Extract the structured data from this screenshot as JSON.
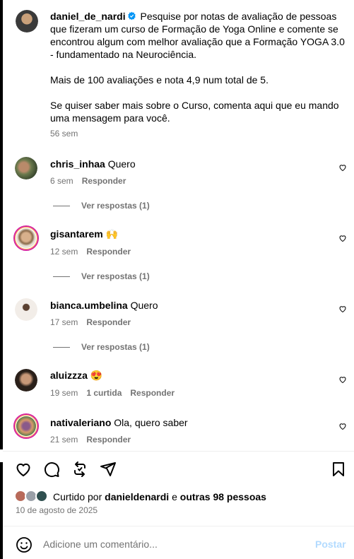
{
  "post": {
    "author": "daniel_de_nardi",
    "caption_p1": "Pesquise por notas de avaliação de pessoas que fizeram um curso de Formação de Yoga Online e comente se encontrou algum com melhor avaliação que a Formação YOGA 3.0 - fundamentado na Neurociência.",
    "caption_p2": "Mais de 100 avaliações e nota 4,9 num total de 5.",
    "caption_p3": "Se quiser saber mais sobre o Curso, comenta aqui que eu mando uma mensagem para você.",
    "time": "56 sem"
  },
  "comments": [
    {
      "user": "chris_inhaa",
      "text": "Quero",
      "time": "6 sem",
      "reply": "Responder",
      "replies": "Ver respostas (1)"
    },
    {
      "user": "gisantarem",
      "text": "🙌",
      "time": "12 sem",
      "reply": "Responder",
      "replies": "Ver respostas (1)"
    },
    {
      "user": "bianca.umbelina",
      "text": "Quero",
      "time": "17 sem",
      "reply": "Responder",
      "replies": "Ver respostas (1)"
    },
    {
      "user": "aluizzza",
      "text": "😍",
      "time": "19 sem",
      "likes": "1 curtida",
      "reply": "Responder"
    },
    {
      "user": "nativaleriano",
      "text": "Ola, quero saber",
      "time": "21 sem",
      "reply": "Responder"
    }
  ],
  "liked": {
    "prefix": "Curtido por",
    "user": "danieldenardi",
    "connector": "e",
    "others": "outras 98 pessoas"
  },
  "date": "10 de agosto de 2025",
  "input": {
    "placeholder": "Adicione um comentário...",
    "post": "Postar"
  },
  "colors": {
    "verified": "#0095f6",
    "muted": "#737373",
    "post_button": "#b3dbff"
  }
}
